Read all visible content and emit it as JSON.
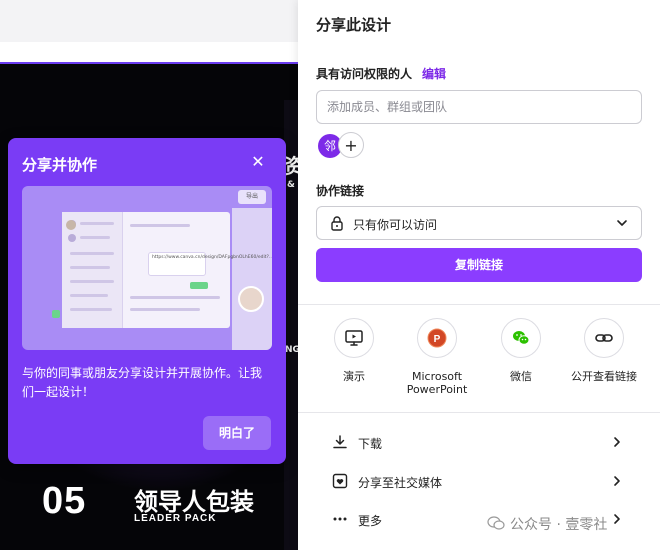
{
  "background": {
    "leader_number": "05",
    "leader_title": "领导人包装",
    "leader_subtitle": "LEADER PACK",
    "fragment_1": "资",
    "fragment_2": "&",
    "fragment_3": "NG"
  },
  "collab_card": {
    "title": "分享并协作",
    "close_icon": "close-icon",
    "preview": {
      "export_label": "导出",
      "link_text": "https://www.canva.cn/design/DAFpgbnOLhE60/edit?...>share&utm"
    },
    "description": "与你的同事或朋友分享设计并开展协作。让我们一起设计！",
    "button_label": "明白了"
  },
  "share_panel": {
    "title": "分享此设计",
    "access_label": "具有访问权限的人",
    "edit_label": "编辑",
    "input_placeholder": "添加成员、群组或团队",
    "avatar_initial": "邻",
    "add_symbol": "+",
    "collab_link_label": "协作链接",
    "access_option": "只有你可以访问",
    "copy_link_label": "复制链接",
    "share_options": [
      {
        "label": "演示",
        "icon": "present-icon"
      },
      {
        "label": "Microsoft PowerPoint",
        "icon": "powerpoint-icon"
      },
      {
        "label": "微信",
        "icon": "wechat-icon"
      },
      {
        "label": "公开查看链接",
        "icon": "link-icon"
      }
    ],
    "rows": [
      {
        "label": "下载",
        "icon": "download-icon"
      },
      {
        "label": "分享至社交媒体",
        "icon": "social-heart-icon"
      },
      {
        "label": "更多",
        "icon": "more-icon"
      }
    ],
    "brand_color": "#8b3dff"
  },
  "watermark": "公众号 · 壹零社"
}
